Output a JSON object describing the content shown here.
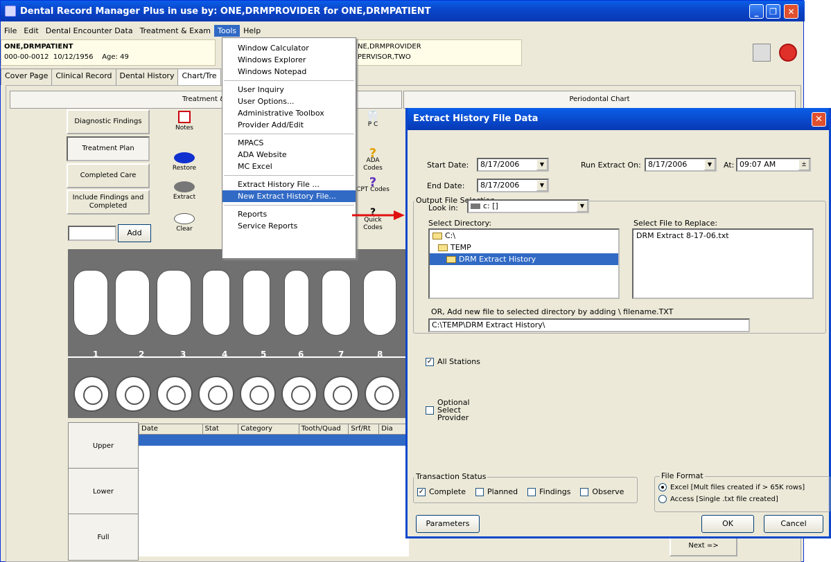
{
  "window": {
    "title": "Dental Record Manager Plus in use by: ONE,DRMPROVIDER for ONE,DRMPATIENT",
    "minimize": "_",
    "maximize": "❐",
    "close": "✕"
  },
  "menubar": [
    "File",
    "Edit",
    "Dental Encounter Data",
    "Treatment & Exam",
    "Tools",
    "Help"
  ],
  "patient": {
    "name": "ONE,DRMPATIENT",
    "ssn": "000-00-0012",
    "dob": "10/12/1956",
    "age": "Age: 49"
  },
  "provider": {
    "line1": "NE,DRMPROVIDER",
    "line2": "PERVISOR,TWO"
  },
  "tabs": [
    "Cover Page",
    "Clinical Record",
    "Dental History",
    "Chart/Tre"
  ],
  "subtabs": {
    "left": "Treatment & I",
    "right": "Periodontal Chart"
  },
  "side_buttons": [
    "Diagnostic Findings",
    "Treatment Plan",
    "Completed Care",
    "Include Findings and Completed"
  ],
  "add_button": "Add",
  "tools": {
    "notes": "Notes",
    "restore": "Restore",
    "extract": "Extract",
    "clear": "Clear",
    "ada_codes": "ADA Codes",
    "cpt_codes": "CPT Codes",
    "quick_codes": "Quick Codes",
    "pc": "P C"
  },
  "tooth_numbers": [
    "1",
    "2",
    "3",
    "4",
    "5",
    "6",
    "7",
    "8"
  ],
  "jaw_buttons": [
    "Upper",
    "Lower",
    "Full"
  ],
  "table_headers": [
    "Date",
    "Stat",
    "Category",
    "Tooth/Quad",
    "Srf/Rt",
    "Dia"
  ],
  "next_button": "Next =>",
  "tools_menu": {
    "items": [
      [
        "Window Calculator",
        "Windows Explorer",
        "Windows Notepad"
      ],
      [
        "User Inquiry",
        "User Options...",
        "Administrative Toolbox",
        "Provider Add/Edit"
      ],
      [
        "MPACS",
        "ADA Website",
        "MC Excel"
      ],
      [
        "Extract History File ...",
        "New Extract History File..."
      ],
      [
        "Reports",
        "Service Reports"
      ]
    ],
    "highlighted": "New Extract History File..."
  },
  "dialog": {
    "title": "Extract History File Data",
    "start_date_label": "Start Date:",
    "start_date": "8/17/2006",
    "end_date_label": "End Date:",
    "end_date": "8/17/2006",
    "run_extract_label": "Run Extract On:",
    "run_extract_date": "8/17/2006",
    "at_label": "At:",
    "at_time": "09:07 AM",
    "output_group": "Output File Selection",
    "look_in_label": "Look in:",
    "look_in_value": "c: []",
    "select_directory_label": "Select Directory:",
    "directories": [
      "C:\\",
      "TEMP",
      "DRM Extract History"
    ],
    "select_file_label": "Select File to Replace:",
    "files": [
      "DRM Extract 8-17-06.txt"
    ],
    "add_new_label": "OR, Add new file to selected directory by adding  \\ filename.TXT",
    "path_value": "C:\\TEMP\\DRM Extract History\\",
    "all_stations": "All Stations",
    "optional_provider": [
      "Optional",
      "Select",
      "Provider"
    ],
    "transaction_group": "Transaction Status",
    "transactions": [
      {
        "label": "Complete",
        "checked": true
      },
      {
        "label": "Planned",
        "checked": false
      },
      {
        "label": "Findings",
        "checked": false
      },
      {
        "label": "Observe",
        "checked": false
      }
    ],
    "file_format_group": "File Format",
    "formats": [
      {
        "label": "Excel [Mult files created if > 65K rows]",
        "selected": true
      },
      {
        "label": "Access [Single .txt file created]",
        "selected": false
      }
    ],
    "parameters_button": "Parameters",
    "ok_button": "OK",
    "cancel_button": "Cancel"
  },
  "colors": {
    "titlebar": "#0a47cc",
    "menu_highlight": "#316ac5",
    "dialog_close": "#e0502e",
    "arrow": "#e01010"
  }
}
